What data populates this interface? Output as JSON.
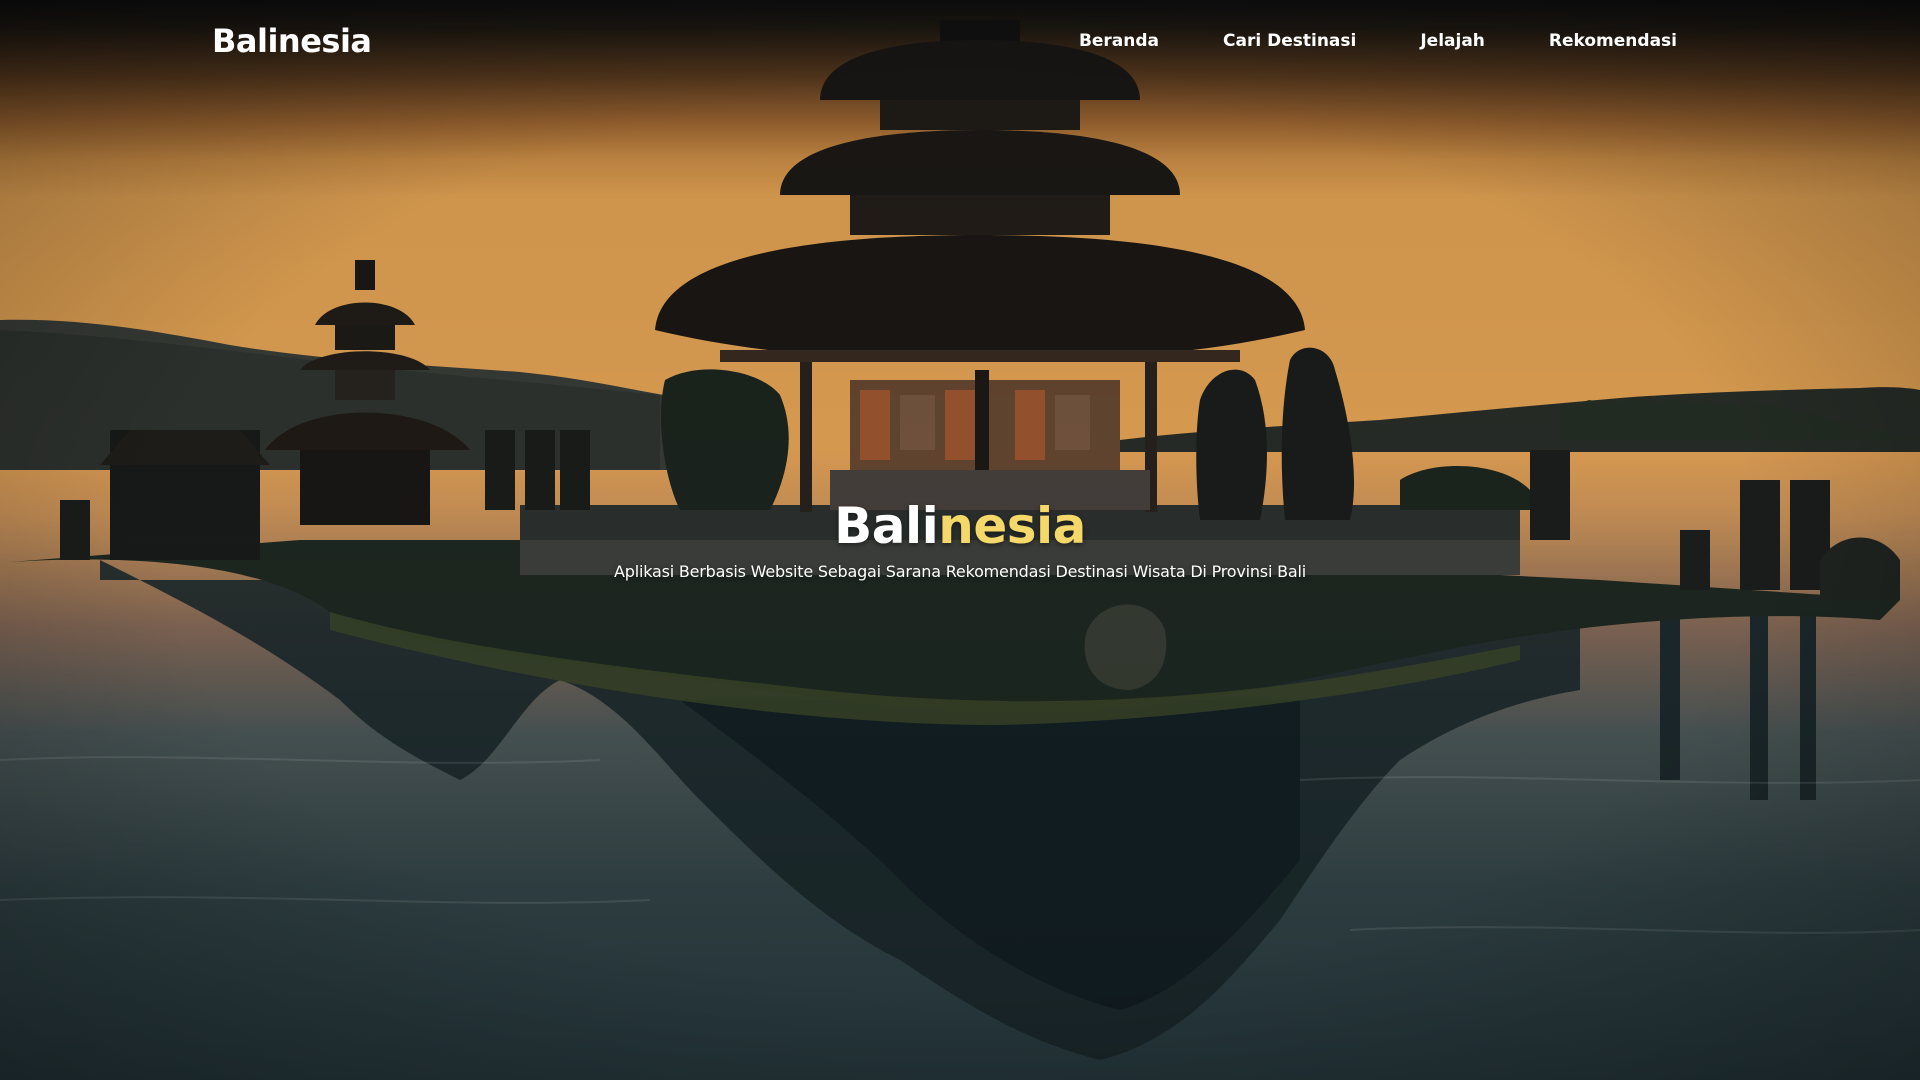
{
  "navbar": {
    "brand": "Balinesia",
    "links": [
      {
        "label": "Beranda"
      },
      {
        "label": "Cari Destinasi"
      },
      {
        "label": "Jelajah"
      },
      {
        "label": "Rekomendasi"
      }
    ]
  },
  "hero": {
    "title_part1": "Bali",
    "title_part2": "nesia",
    "subtitle": "Aplikasi Berbasis Website Sebagai Sarana Rekomendasi Destinasi Wisata Di Provinsi Bali",
    "background": "temple-on-lake-sunset-image"
  },
  "colors": {
    "accent": "#f4d86a",
    "text": "#ffffff",
    "sky_top": "#141414",
    "sky_horizon": "#e9a24e",
    "water_dark": "#1d3138"
  }
}
